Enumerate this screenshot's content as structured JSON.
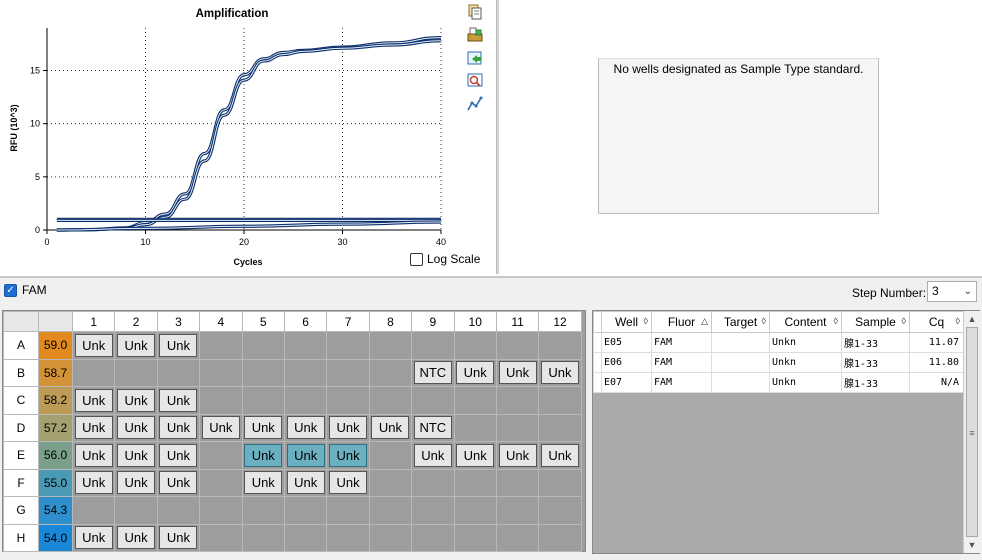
{
  "chart": {
    "title": "Amplification",
    "xlabel": "Cycles",
    "ylabel": "RFU (10^3)",
    "log_scale_label": "Log Scale",
    "log_scale_checked": false,
    "x_ticks": [
      "0",
      "10",
      "20",
      "30",
      "40"
    ],
    "y_ticks": [
      "0",
      "5",
      "10",
      "15"
    ]
  },
  "chart_data": {
    "type": "line",
    "title": "Amplification",
    "xlabel": "Cycles",
    "ylabel": "RFU (10^3)",
    "xlim": [
      0,
      40
    ],
    "ylim": [
      0,
      19
    ],
    "grid": true,
    "legend": "none",
    "series": [
      {
        "x": [
          1,
          4,
          8,
          10,
          12,
          14,
          16,
          18,
          20,
          22,
          24,
          26,
          30,
          35,
          40
        ],
        "y": [
          0,
          0.02,
          0.2,
          0.7,
          1.5,
          3.4,
          7.2,
          11.3,
          14.6,
          16.1,
          16.7,
          16.9,
          17.2,
          17.6,
          18.1
        ]
      },
      {
        "x": [
          1,
          4,
          8,
          10,
          12,
          14,
          16,
          18,
          20,
          22,
          24,
          26,
          30,
          35,
          40
        ],
        "y": [
          0,
          0.02,
          0.15,
          0.5,
          1.2,
          2.9,
          6.5,
          10.8,
          14.1,
          15.9,
          16.5,
          16.8,
          17.1,
          17.4,
          17.8
        ]
      },
      {
        "x": [
          1,
          10,
          20,
          30,
          40
        ],
        "y": [
          1.0,
          1.0,
          1.0,
          1.0,
          1.0
        ]
      },
      {
        "x": [
          1,
          10,
          20,
          30,
          40
        ],
        "y": [
          0.9,
          0.9,
          0.9,
          0.9,
          0.9
        ]
      },
      {
        "x": [
          1,
          10,
          20,
          30,
          40
        ],
        "y": [
          0.0,
          0.15,
          0.35,
          0.55,
          0.75
        ]
      }
    ]
  },
  "standard_panel": {
    "message": "No wells designated as Sample Type standard."
  },
  "fluor_bar": {
    "fam_label": "FAM",
    "fam_checked": true,
    "step_label": "Step Number:",
    "step_value": "3"
  },
  "plate": {
    "columns": [
      "1",
      "2",
      "3",
      "4",
      "5",
      "6",
      "7",
      "8",
      "9",
      "10",
      "11",
      "12"
    ],
    "rows": [
      {
        "label": "A",
        "temp": "59.0",
        "color": "#e28a1f",
        "wells": [
          "Unk",
          "Unk",
          "Unk",
          "",
          "",
          "",
          "",
          "",
          "",
          "",
          "",
          ""
        ]
      },
      {
        "label": "B",
        "temp": "58.7",
        "color": "#d39236",
        "wells": [
          "",
          "",
          "",
          "",
          "",
          "",
          "",
          "",
          "NTC",
          "Unk",
          "Unk",
          "Unk"
        ]
      },
      {
        "label": "C",
        "temp": "58.2",
        "color": "#bd9a55",
        "wells": [
          "Unk",
          "Unk",
          "Unk",
          "",
          "",
          "",
          "",
          "",
          "",
          "",
          "",
          ""
        ]
      },
      {
        "label": "D",
        "temp": "57.2",
        "color": "#a5a06f",
        "wells": [
          "Unk",
          "Unk",
          "Unk",
          "Unk",
          "Unk",
          "Unk",
          "Unk",
          "Unk",
          "NTC",
          "",
          "",
          ""
        ]
      },
      {
        "label": "E",
        "temp": "56.0",
        "color": "#7aa08c",
        "wells": [
          "Unk",
          "Unk",
          "Unk",
          "",
          "Unk",
          "Unk",
          "Unk",
          "",
          "Unk",
          "Unk",
          "Unk",
          "Unk"
        ]
      },
      {
        "label": "F",
        "temp": "55.0",
        "color": "#4a9ab6",
        "wells": [
          "Unk",
          "Unk",
          "Unk",
          "",
          "Unk",
          "Unk",
          "Unk",
          "",
          "",
          "",
          "",
          ""
        ]
      },
      {
        "label": "G",
        "temp": "54.3",
        "color": "#2f8fcc",
        "wells": [
          "",
          "",
          "",
          "",
          "",
          "",
          "",
          "",
          "",
          "",
          "",
          ""
        ]
      },
      {
        "label": "H",
        "temp": "54.0",
        "color": "#1a86d8",
        "wells": [
          "Unk",
          "Unk",
          "Unk",
          "",
          "",
          "",
          "",
          "",
          "",
          "",
          "",
          ""
        ]
      }
    ],
    "selected": [
      "E5",
      "E6",
      "E7"
    ]
  },
  "results_table": {
    "headers": [
      "Well",
      "Fluor",
      "Target",
      "Content",
      "Sample",
      "Cq"
    ],
    "sort_glyphs": [
      "◊",
      "△",
      "◊",
      "◊",
      "◊",
      "◊"
    ],
    "rows": [
      [
        "E05",
        "FAM",
        "",
        "Unkn",
        "腺1-33",
        "11.07"
      ],
      [
        "E06",
        "FAM",
        "",
        "Unkn",
        "腺1-33",
        "11.80"
      ],
      [
        "E07",
        "FAM",
        "",
        "Unkn",
        "腺1-33",
        "N/A"
      ]
    ]
  },
  "icons": {
    "toolbar": [
      "copy-icon",
      "print-icon",
      "export-icon",
      "zoom-icon",
      "graph-settings-icon"
    ],
    "scroll_up": "▲",
    "scroll_down": "▼",
    "scroll_grip": "≡",
    "select_chevron": "⌄"
  }
}
